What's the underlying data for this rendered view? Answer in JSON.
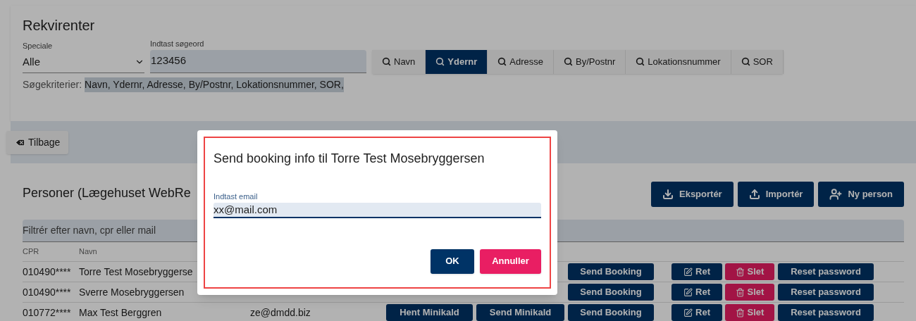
{
  "title": "Rekvirenter",
  "speciale": {
    "label": "Speciale",
    "value": "Alle"
  },
  "search": {
    "label": "Indtast søgeord",
    "value": "123456"
  },
  "search_buttons": [
    {
      "label": "Navn",
      "selected": false
    },
    {
      "label": "Ydernr",
      "selected": true
    },
    {
      "label": "Adresse",
      "selected": false
    },
    {
      "label": "By/Postnr",
      "selected": false
    },
    {
      "label": "Lokationsnummer",
      "selected": false
    },
    {
      "label": "SOR",
      "selected": false
    }
  ],
  "criteria": {
    "label": "Søgekriterier:",
    "value": "Navn, Ydernr, Adresse, By/Postnr, Lokationsnummer, SOR,"
  },
  "back_button": "Tilbage",
  "persons": {
    "title": "Personer (Lægehuset WebRe",
    "actions": [
      {
        "kind": "export",
        "label": "Eksportér"
      },
      {
        "kind": "import",
        "label": "Importér"
      },
      {
        "kind": "add",
        "label": "Ny person"
      }
    ],
    "filter": {
      "placeholder": "Filtrér efter navn, cpr eller mail"
    },
    "columns": [
      "CPR",
      "Navn"
    ],
    "rows": [
      {
        "cpr": "010490****",
        "name": "Torre Test Mosebryggerse",
        "buttons": [
          {
            "kind": "plain",
            "label": "Send Booking"
          },
          {
            "kind": "edit",
            "label": "Ret"
          },
          {
            "kind": "delete",
            "label": "Slet"
          },
          {
            "kind": "plain",
            "label": "Reset password"
          }
        ]
      },
      {
        "cpr": "010490****",
        "name": "Sverre Mosebryggersen",
        "buttons": [
          {
            "kind": "plain",
            "label": "Send Booking"
          },
          {
            "kind": "edit",
            "label": "Ret"
          },
          {
            "kind": "delete",
            "label": "Slet"
          },
          {
            "kind": "plain",
            "label": "Reset password"
          }
        ]
      },
      {
        "cpr": "010772****",
        "name": "Max Test Berggren",
        "email": "ze@dmdd.biz",
        "buttons": [
          {
            "kind": "plain",
            "label": "Hent Minikald"
          },
          {
            "kind": "plain",
            "label": "Send Minikald"
          },
          {
            "kind": "plain",
            "label": "Send Booking"
          },
          {
            "kind": "edit",
            "label": "Ret"
          },
          {
            "kind": "delete",
            "label": "Slet"
          },
          {
            "kind": "plain",
            "label": "Reset password"
          }
        ]
      }
    ]
  },
  "dialog": {
    "title": "Send booking info til Torre Test Mosebryggersen",
    "field_label": "Indtast email",
    "field_value": "xx@mail.com",
    "ok": "OK",
    "cancel": "Annuller"
  }
}
